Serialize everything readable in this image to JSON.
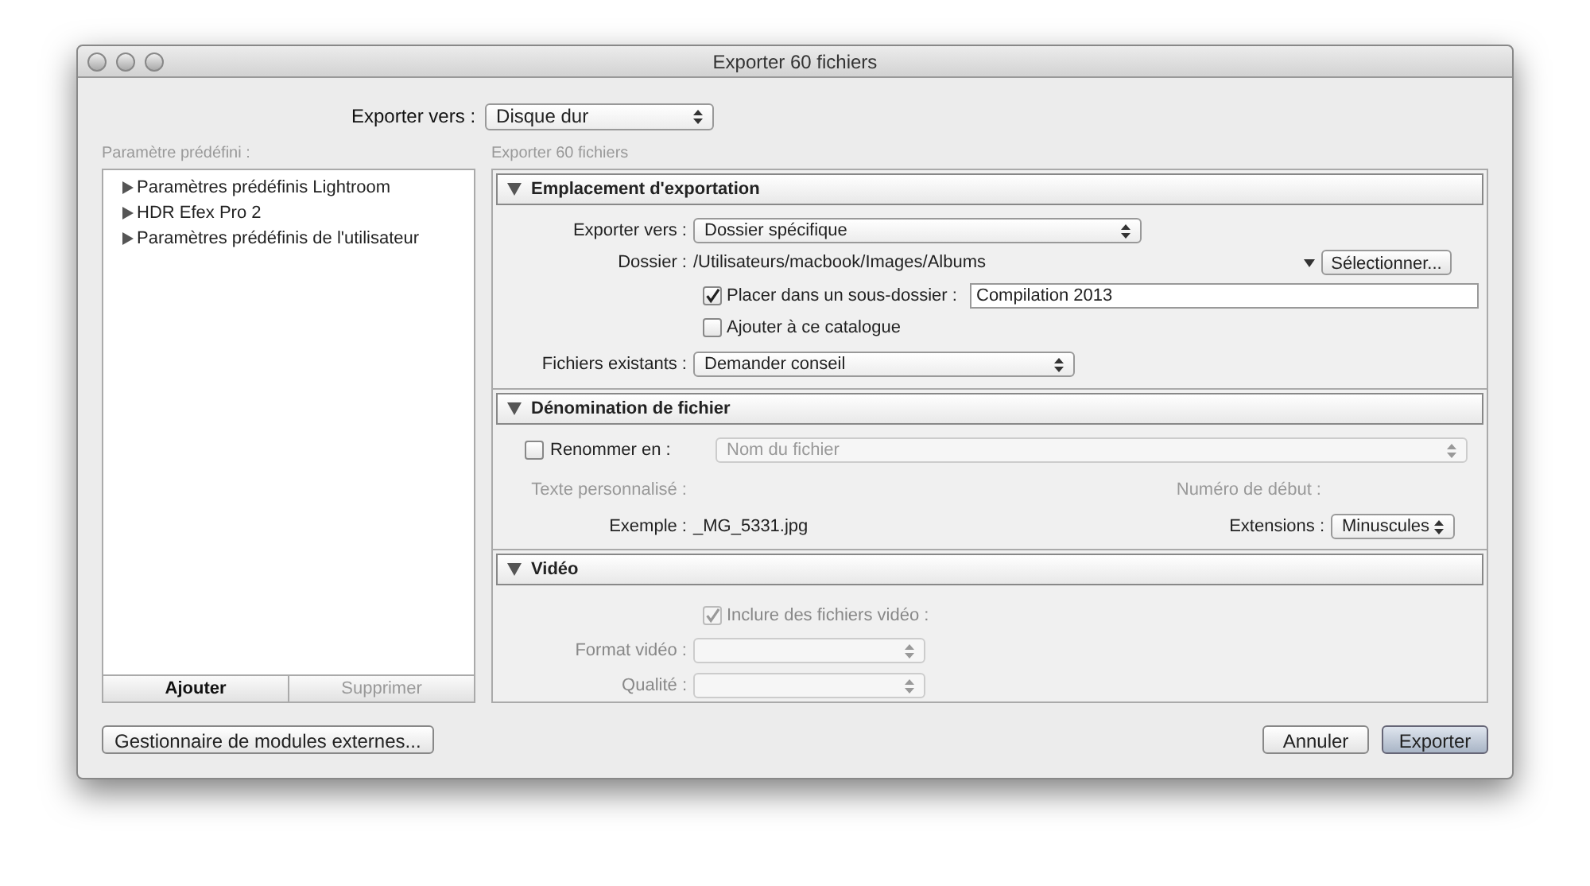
{
  "window": {
    "title": "Exporter 60 fichiers"
  },
  "export_to": {
    "label": "Exporter vers :",
    "value": "Disque dur"
  },
  "presets": {
    "label": "Paramètre prédéfini :",
    "items": [
      {
        "label": "Paramètres prédéfinis Lightroom",
        "expanded": false
      },
      {
        "label": "HDR Efex Pro 2",
        "expanded": false
      },
      {
        "label": "Paramètres prédéfinis de l'utilisateur",
        "expanded": false
      }
    ],
    "add_button": {
      "label": "Ajouter",
      "disabled": false
    },
    "remove_button": {
      "label": "Supprimer",
      "disabled": true
    }
  },
  "panel_title": "Exporter 60 fichiers",
  "location": {
    "title": "Emplacement d'exportation",
    "expanded": true,
    "export_to": {
      "label": "Exporter vers :",
      "value": "Dossier spécifique"
    },
    "folder": {
      "label": "Dossier :",
      "path": "/Utilisateurs/macbook/Images/Albums"
    },
    "choose_button": "Sélectionner...",
    "subfolder": {
      "label": "Placer dans un sous-dossier :",
      "checked": true,
      "value": "Compilation 2013"
    },
    "add_to_catalog": {
      "label": "Ajouter à ce catalogue",
      "checked": false
    },
    "existing": {
      "label": "Fichiers existants :",
      "value": "Demander conseil"
    }
  },
  "naming": {
    "title": "Dénomination de fichier",
    "expanded": true,
    "rename": {
      "label": "Renommer en :",
      "checked": false,
      "value": "Nom du fichier",
      "disabled": true
    },
    "custom_text": {
      "label": "Texte personnalisé :",
      "disabled": true
    },
    "start_number": {
      "label": "Numéro de début :",
      "disabled": true
    },
    "example": {
      "label": "Exemple :",
      "value": "_MG_5331.jpg"
    },
    "extensions": {
      "label": "Extensions :",
      "value": "Minuscules"
    }
  },
  "video": {
    "title": "Vidéo",
    "expanded": true,
    "include": {
      "label": "Inclure des fichiers vidéo :",
      "checked": true,
      "disabled": true
    },
    "format": {
      "label": "Format vidéo :",
      "disabled": true
    },
    "quality": {
      "label": "Qualité :",
      "disabled": true
    }
  },
  "footer": {
    "plugin_button": "Gestionnaire de modules externes...",
    "cancel_button": "Annuler",
    "export_button": "Exporter"
  }
}
